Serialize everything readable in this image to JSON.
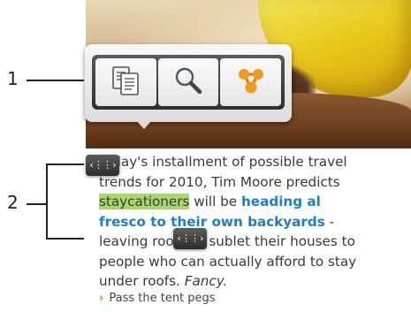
{
  "callouts": {
    "first": "1",
    "second": "2"
  },
  "toolbar": {
    "items": [
      {
        "icon": "copy-icon"
      },
      {
        "icon": "search-icon"
      },
      {
        "icon": "share-icon"
      }
    ]
  },
  "article": {
    "p1": "today's installment of possible travel trends for 2010, Tim Moore predicts",
    "highlight": "staycationers",
    "p2": " will be ",
    "link": "heading al fresco to their own backyards",
    "p3": " - leaving room to sublet their houses to people who can actually afford to stay under roofs. ",
    "fancy": "Fancy."
  },
  "more_link": "Pass the tent pegs",
  "handles": {
    "start": "‹⋮⋮›",
    "end": "‹⋮⋮›"
  },
  "colors": {
    "highlight": "#a9d86a",
    "link": "#1a7fd1",
    "accent": "#ff7a00"
  }
}
